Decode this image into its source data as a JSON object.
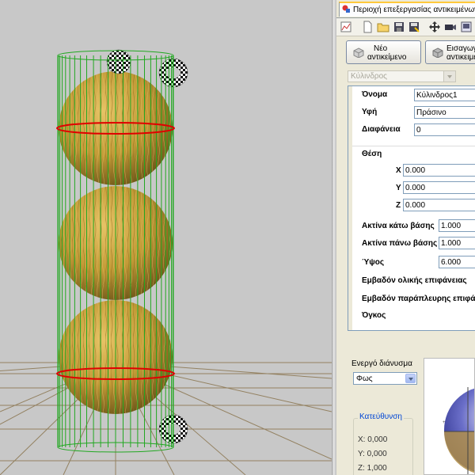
{
  "panel_tab": {
    "title": "Περιοχή επεξεργασίας αντικειμένων"
  },
  "toolbar": {
    "icons": [
      "chart-icon",
      "new-file-icon",
      "open-folder-icon",
      "save-icon",
      "save-as-icon",
      "move-icon",
      "camera-icon",
      "view-icon"
    ]
  },
  "buttons": {
    "new_object": {
      "line1": "Νέο",
      "line2": "αντικείμενο"
    },
    "import": {
      "line1": "Εισαγωγή",
      "line2": "αντικειμένου"
    }
  },
  "object_type": {
    "value": "Κύλινδρος"
  },
  "properties": {
    "name": {
      "label": "Όνομα",
      "value": "Κύλινδρος1"
    },
    "texture": {
      "label": "Υφή",
      "value": "Πράσινο"
    },
    "transparency": {
      "label": "Διαφάνεια",
      "value": "0"
    },
    "position": {
      "label": "Θέση",
      "x": {
        "label": "X",
        "value": "0.000"
      },
      "y": {
        "label": "Y",
        "value": "0.000"
      },
      "z": {
        "label": "Z",
        "value": "0.000"
      }
    },
    "bottom_radius": {
      "label": "Ακτίνα κάτω βάσης",
      "value": "1.000"
    },
    "top_radius": {
      "label": "Ακτίνα πάνω βάσης",
      "value": "1.000"
    },
    "height": {
      "label": "Ύψος",
      "value": "6.000"
    },
    "total_area": {
      "label": "Εμβαδόν ολικής επιφάνειας"
    },
    "lateral_area": {
      "label": "Εμβαδόν παράπλευρης επιφάνειας"
    },
    "volume": {
      "label": "Όγκος"
    }
  },
  "active_vector": {
    "label": "Ενεργό διάνυσμα",
    "value": "Φως"
  },
  "direction": {
    "title": "Κατεύθυνση",
    "x": "X: 0,000",
    "y": "Y: 0,000",
    "z": "Z: 1,000"
  },
  "colors": {
    "viewport_bg": "#c8c8c8",
    "wire": "#22a822",
    "ring": "#e00000",
    "sphere": "#b9972e",
    "panel_bg": "#ece9d8"
  }
}
